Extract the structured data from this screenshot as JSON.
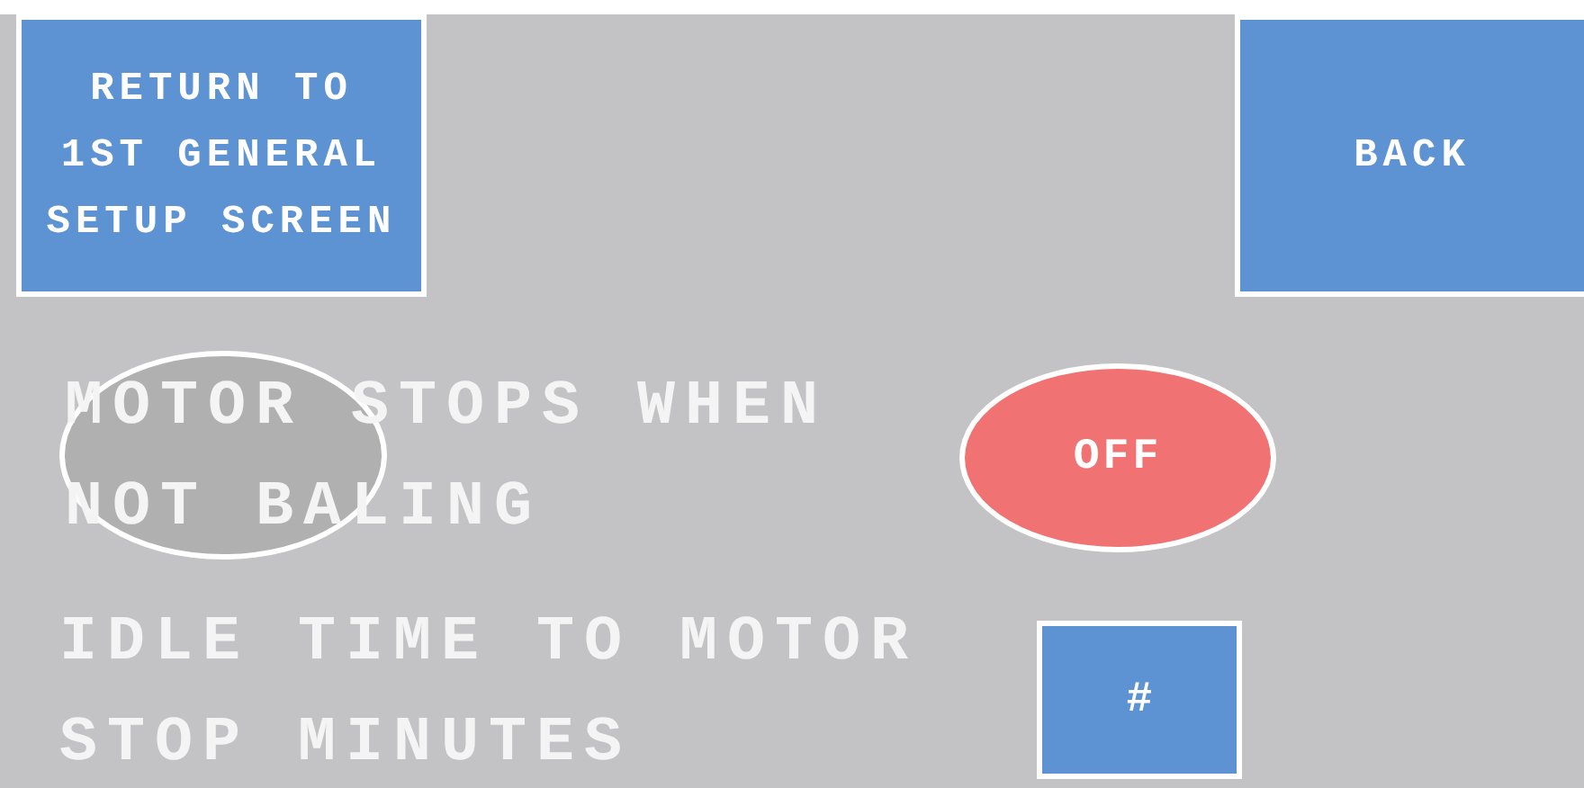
{
  "top_buttons": [
    {
      "kind": "return",
      "label": "RETURN TO\n1ST GENERAL\nSETUP SCREEN"
    },
    {
      "kind": "back",
      "label": "BACK"
    }
  ],
  "settings": [
    {
      "kind": "toggle",
      "label": "MOTOR STOPS WHEN\nNOT BALING",
      "value": "OFF",
      "on": false
    },
    {
      "kind": "number",
      "label": "IDLE TIME TO MOTOR\nSTOP MINUTES",
      "value": "#"
    }
  ]
}
